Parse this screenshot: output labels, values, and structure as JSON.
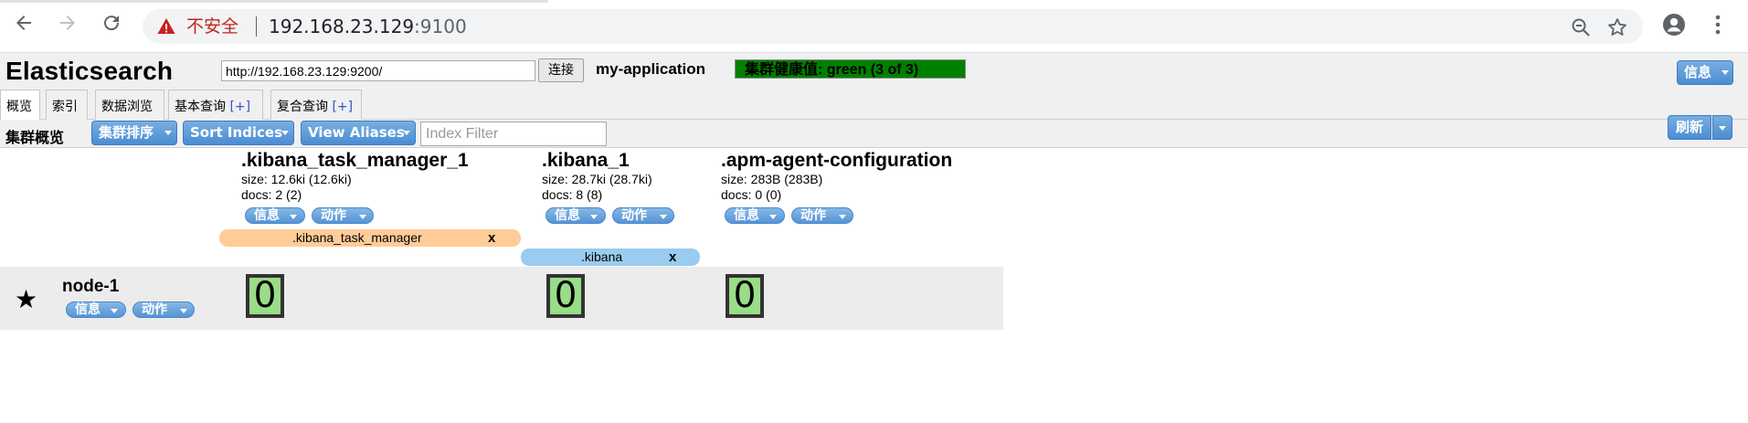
{
  "browser": {
    "security_label": "不安全",
    "url_host": "192.168.23.129",
    "url_port": ":9100"
  },
  "app": {
    "title": "Elasticsearch",
    "connect_url": "http://192.168.23.129:9200/",
    "connect_label": "连接",
    "cluster_name": "my-application",
    "health_text": "集群健康值: green (3 of 3)",
    "info_label": "信息",
    "health_color": "#008000"
  },
  "tabs": [
    {
      "label": "概览"
    },
    {
      "label": "索引"
    },
    {
      "label": "数据浏览"
    },
    {
      "label": "基本查询",
      "plus": "[+]"
    },
    {
      "label": "复合查询",
      "plus": "[+]"
    }
  ],
  "toolbar": {
    "title": "集群概览",
    "sort_cluster": "集群排序",
    "sort_indices": "Sort Indices",
    "view_aliases": "View Aliases",
    "index_filter_placeholder": "Index Filter",
    "refresh": "刷新"
  },
  "indices": [
    {
      "name": ".kibana_task_manager_1",
      "size": "size: 12.6ki (12.6ki)",
      "docs": "docs: 2 (2)",
      "info": "信息",
      "action": "动作"
    },
    {
      "name": ".kibana_1",
      "size": "size: 28.7ki (28.7ki)",
      "docs": "docs: 8 (8)",
      "info": "信息",
      "action": "动作"
    },
    {
      "name": ".apm-agent-configuration",
      "size": "size: 283B (283B)",
      "docs": "docs: 0 (0)",
      "info": "信息",
      "action": "动作"
    }
  ],
  "aliases": [
    {
      "name": ".kibana_task_manager",
      "close": "x",
      "color": "#ffcc99"
    },
    {
      "name": ".kibana",
      "close": "x",
      "color": "#99ccee"
    }
  ],
  "node": {
    "name": "node-1",
    "info": "信息",
    "action": "动作",
    "star": "★",
    "shards": [
      "0",
      "0",
      "0"
    ],
    "shard_color": "#99dd88"
  }
}
